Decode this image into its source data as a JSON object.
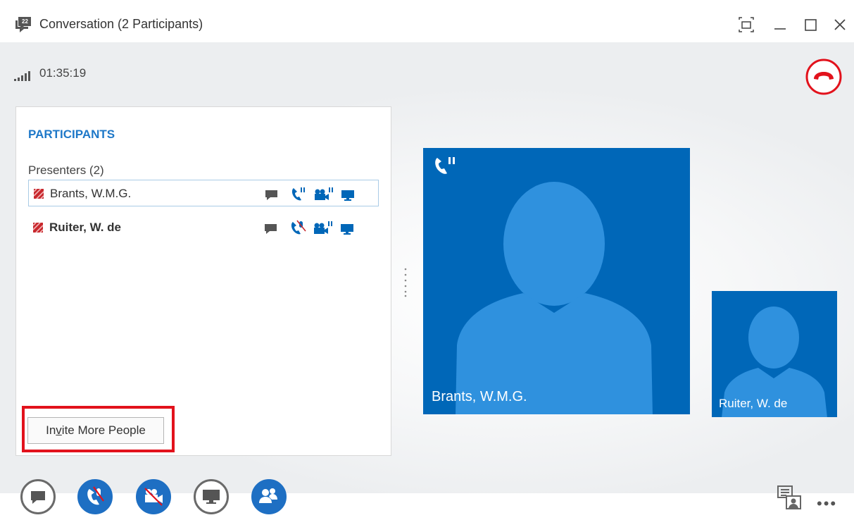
{
  "window": {
    "title": "Conversation (2 Participants)"
  },
  "call": {
    "duration": "01:35:19"
  },
  "participants_panel": {
    "heading": "PARTICIPANTS",
    "group_label": "Presenters (2)",
    "participants": [
      {
        "name": "Brants, W.M.G.",
        "bold": false,
        "selected": true,
        "audio_muted": false
      },
      {
        "name": "Ruiter, W. de",
        "bold": true,
        "selected": false,
        "audio_muted": true
      }
    ],
    "invite_button": {
      "pre": "In",
      "accel": "v",
      "post": "ite More People"
    }
  },
  "video": {
    "main_tile_name": "Brants, W.M.G.",
    "small_tile_name": "Ruiter, W. de"
  },
  "toolbar": {
    "buttons": [
      "im",
      "audio-muted",
      "video-off",
      "present",
      "participants"
    ],
    "more_label": "•••"
  },
  "colors": {
    "accent_blue": "#0067b8",
    "button_blue": "#1e6fc3",
    "heading_blue": "#1e78c8",
    "hangup_red": "#e2121c",
    "presence_busy": "#c8282d",
    "highlight_red": "#e2121c"
  },
  "icons": {
    "app": "conversation-icon",
    "hangup": "hang-up-icon",
    "signal": "signal-strength-icon"
  }
}
